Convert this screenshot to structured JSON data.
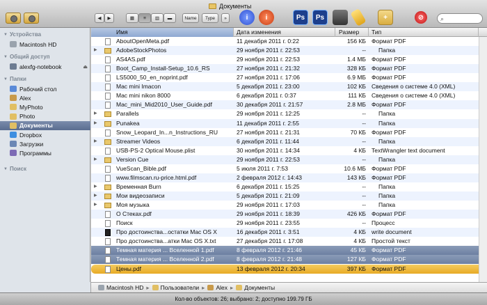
{
  "window": {
    "title": "Документы"
  },
  "toolbar": {
    "view_name": "Name",
    "view_type": "Type",
    "icons": [
      "info-blue",
      "info-orange",
      "photoshop",
      "photoshop-2",
      "preview",
      "tag",
      "new-folder",
      "stop"
    ],
    "search_placeholder": ""
  },
  "sidebar": {
    "devices_title": "Устройства",
    "devices": [
      {
        "label": "Macintosh HD",
        "icon": "hd-icon"
      }
    ],
    "shared_title": "Общий доступ",
    "shared": [
      {
        "label": "alexfg-notebook",
        "icon": "computer-icon"
      }
    ],
    "places_title": "Папки",
    "places": [
      {
        "label": "Рабочий стол",
        "icon": "desktop-icon"
      },
      {
        "label": "Alex",
        "icon": "home-icon"
      },
      {
        "label": "MyPhoto",
        "icon": "folder-icon"
      },
      {
        "label": "Photo",
        "icon": "folder-icon"
      },
      {
        "label": "Документы",
        "icon": "documents-icon"
      },
      {
        "label": "Dropbox",
        "icon": "dropbox-icon"
      },
      {
        "label": "Загрузки",
        "icon": "downloads-icon"
      },
      {
        "label": "Программы",
        "icon": "applications-icon"
      }
    ],
    "search_title": "Поиск"
  },
  "columns": {
    "name": "Имя",
    "date": "Дата изменения",
    "size": "Размер",
    "kind": "Тип"
  },
  "files": [
    {
      "name": "AboutOpenMeta.pdf",
      "date": "11 декабря 2011 г. 0:22",
      "size": "156 КБ",
      "kind": "Формат PDF",
      "folder": false
    },
    {
      "name": "AdobeStockPhotos",
      "date": "29 ноября 2011 г. 22:53",
      "size": "--",
      "kind": "Папка",
      "folder": true
    },
    {
      "name": "AS4AS.pdf",
      "date": "29 ноября 2011 г. 22:53",
      "size": "1.4 МБ",
      "kind": "Формат PDF",
      "folder": false
    },
    {
      "name": "Boot_Camp_Install-Setup_10.6_RS",
      "date": "27 ноября 2011 г. 21:32",
      "size": "328 КБ",
      "kind": "Формат PDF",
      "folder": false
    },
    {
      "name": "LS5000_50_en_noprint.pdf",
      "date": "27 ноября 2011 г. 17:06",
      "size": "6.9 МБ",
      "kind": "Формат PDF",
      "folder": false
    },
    {
      "name": "Mac mini Imacon",
      "date": "5 декабря 2011 г. 23:00",
      "size": "102 КБ",
      "kind": "Сведения о системе 4.0 (XML)",
      "folder": false
    },
    {
      "name": "Mac mini nikon 8000",
      "date": "6 декабря 2011 г. 0:37",
      "size": "111 КБ",
      "kind": "Сведения о системе 4.0 (XML)",
      "folder": false
    },
    {
      "name": "Mac_mini_Mid2010_User_Guide.pdf",
      "date": "30 декабря 2011 г. 21:57",
      "size": "2.8 МБ",
      "kind": "Формат PDF",
      "folder": false
    },
    {
      "name": "Parallels",
      "date": "29 ноября 2011 г. 12:25",
      "size": "--",
      "kind": "Папка",
      "folder": true
    },
    {
      "name": "Punakea",
      "date": "11 декабря 2011 г. 2:55",
      "size": "--",
      "kind": "Папка",
      "folder": true
    },
    {
      "name": "Snow_Leopard_In...n_Instructions_RU",
      "date": "27 ноября 2011 г. 21:31",
      "size": "70 КБ",
      "kind": "Формат PDF",
      "folder": false
    },
    {
      "name": "Streamer Videos",
      "date": "6 декабря 2011 г. 11:44",
      "size": "--",
      "kind": "Папка",
      "folder": true
    },
    {
      "name": "USB-PS-2 Optical Mouse.plist",
      "date": "30 ноября 2011 г. 14:34",
      "size": "4 КБ",
      "kind": "TextWrangler text document",
      "folder": false
    },
    {
      "name": "Version Cue",
      "date": "29 ноября 2011 г. 22:53",
      "size": "--",
      "kind": "Папка",
      "folder": true
    },
    {
      "name": "VueScan_Bible.pdf",
      "date": "5 июля 2011 г. 7:53",
      "size": "10.6 МБ",
      "kind": "Формат PDF",
      "folder": false
    },
    {
      "name": "www.filmscan.ru-price.html.pdf",
      "date": "2 февраля 2012 г. 14:43",
      "size": "143 КБ",
      "kind": "Формат PDF",
      "folder": false
    },
    {
      "name": "Временная Burn",
      "date": "6 декабря 2011 г. 15:25",
      "size": "--",
      "kind": "Папка",
      "folder": true
    },
    {
      "name": "Мои видеозаписи",
      "date": "5 декабря 2011 г. 21:09",
      "size": "--",
      "kind": "Папка",
      "folder": true
    },
    {
      "name": "Моя музыка",
      "date": "29 ноября 2011 г. 17:03",
      "size": "--",
      "kind": "Папка",
      "folder": true
    },
    {
      "name": "О Стеках.pdf",
      "date": "29 ноября 2011 г. 18:39",
      "size": "426 КБ",
      "kind": "Формат PDF",
      "folder": false
    },
    {
      "name": "Поиск",
      "date": "29 ноября 2011 г. 23:55",
      "size": "--",
      "kind": "Процесс",
      "folder": false
    },
    {
      "name": "Про достоинства...остатки Mac OS X",
      "date": "16 декабря 2011 г. 3:51",
      "size": "4 КБ",
      "kind": "write document",
      "folder": false,
      "app": true
    },
    {
      "name": "Про достоинства...атки Mac OS X.txt",
      "date": "27 декабря 2011 г. 17:08",
      "size": "4 КБ",
      "kind": "Простой текст",
      "folder": false
    },
    {
      "name": "Темная материя ... Вселенной 1.pdf",
      "date": "8 февраля 2012 г. 21:46",
      "size": "45 КБ",
      "kind": "Формат PDF",
      "folder": false,
      "state": "sel"
    },
    {
      "name": "Темная материя ... Вселенной 2.pdf",
      "date": "8 февраля 2012 г. 21:48",
      "size": "127 КБ",
      "kind": "Формат PDF",
      "folder": false,
      "state": "sel"
    },
    {
      "name": "Цены.pdf",
      "date": "13 февраля 2012 г. 20:34",
      "size": "397 КБ",
      "kind": "Формат PDF",
      "folder": false,
      "state": "focus"
    }
  ],
  "path": [
    "Macintosh HD",
    "Пользователи",
    "Alex",
    "Документы"
  ],
  "status": "Кол-во объектов: 26; выбрано: 2; доступно 199.79 ГБ"
}
